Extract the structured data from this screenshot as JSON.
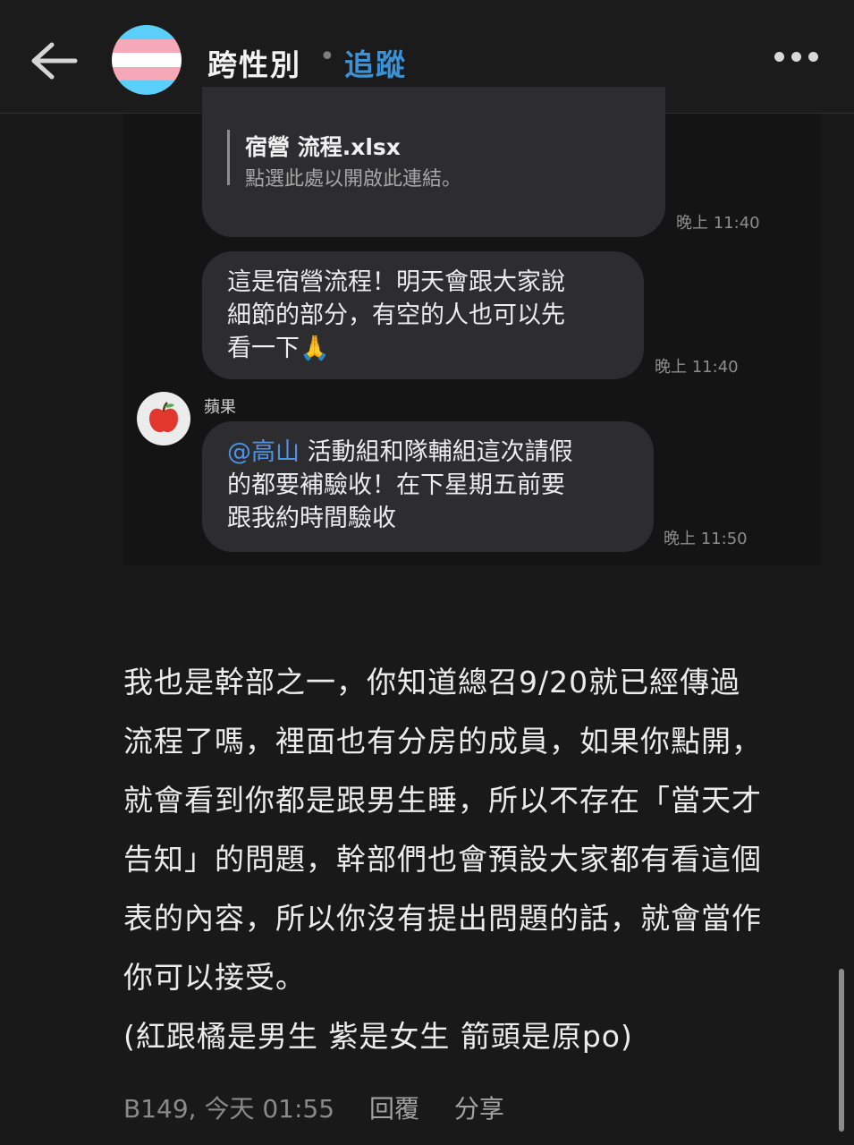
{
  "header": {
    "back_icon": "back-arrow-icon",
    "board_title": "跨性別",
    "separator": "•",
    "follow_label": "追蹤",
    "more_icon": "more-dots-icon",
    "avatar_colors": [
      "#5bcefa",
      "#f5a9b8",
      "#ffffff",
      "#f5a9b8",
      "#5bcefa"
    ]
  },
  "chat": {
    "file_card": {
      "filename": "宿營 流程.xlsx",
      "hint": "點選此處以開啟此連結。",
      "time": "晚上 11:40"
    },
    "message1": {
      "lines": [
        "這是宿營流程！明天會跟大家說",
        "細節的部分，有空的人也可以先",
        "看一下🙏"
      ],
      "time": "晚上 11:40"
    },
    "message2": {
      "sender": "蘋果",
      "avatar_icon": "apple-icon",
      "mention": "@高山",
      "line1_rest": " 活動組和隊輔組這次請假",
      "line2": "的都要補驗收！在下星期五前要",
      "line3": "跟我約時間驗收",
      "time": "晚上 11:50"
    }
  },
  "post": {
    "lines": [
      "我也是幹部之一，你知道總召9/20就已經傳過",
      "流程了嗎，裡面也有分房的成員，如果你點開，",
      "就會看到你都是跟男生睡，所以不存在「當天才",
      "告知」的問題，幹部們也會預設大家都有看這個",
      "表的內容，所以你沒有提出問題的話，就會當作",
      "你可以接受。",
      "(紅跟橘是男生 紫是女生 箭頭是原po)"
    ]
  },
  "meta": {
    "floor_time": "B149, 今天 01:55",
    "reply_label": "回覆",
    "share_label": "分享"
  }
}
